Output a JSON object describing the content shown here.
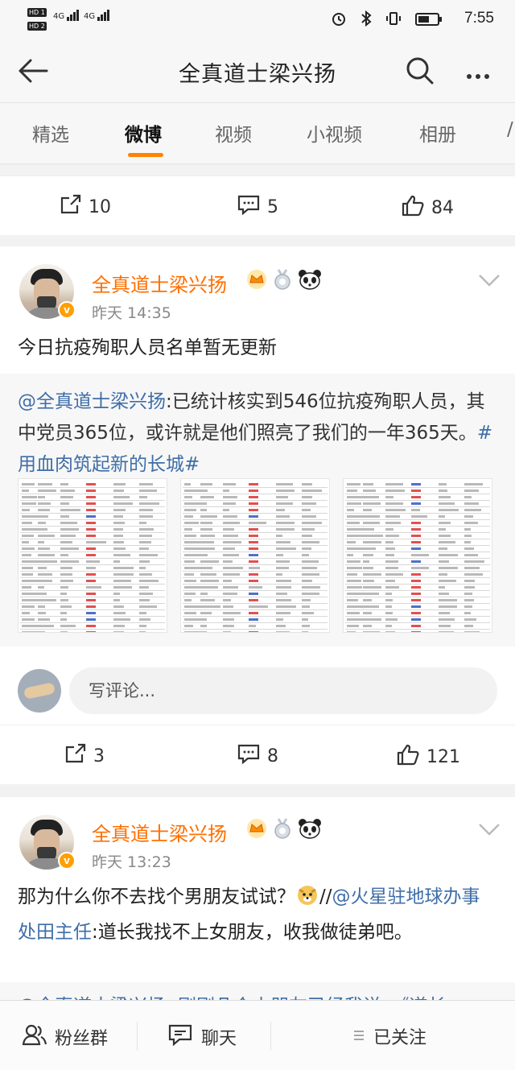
{
  "status_bar": {
    "sim1": "HD 1",
    "sim2": "HD 2",
    "net1": "4G",
    "net2": "4G",
    "time": "7:55"
  },
  "header": {
    "title": "全真道士梁兴扬",
    "icons": [
      "back-arrow-icon",
      "search-icon",
      "more-icon"
    ]
  },
  "tabs": [
    {
      "label": "精选"
    },
    {
      "label": "微博"
    },
    {
      "label": "视频"
    },
    {
      "label": "小视频"
    },
    {
      "label": "相册"
    },
    {
      "label": "/"
    }
  ],
  "top_actions": {
    "repost": "10",
    "comment": "5",
    "like": "84"
  },
  "posts": [
    {
      "author": "全真道士梁兴扬",
      "time": "昨天 14:35",
      "text": "今日抗疫殉职人员名单暂无更新",
      "repost": {
        "mention": "@全真道士梁兴扬",
        "body": ":已统计核实到546位抗疫殉职人员，其中党员365位，或许就是他们照亮了我们的一年365天。",
        "hashtag": "#用血肉筑起新的长城#"
      },
      "comment_placeholder": "写评论...",
      "actions": {
        "repost": "3",
        "comment": "8",
        "like": "121"
      }
    },
    {
      "author": "全真道士梁兴扬",
      "time": "昨天 13:23",
      "text_before": "那为什么你不去找个男朋友试试？",
      "text_sep": "//",
      "mention": "@火星驻地球办事处田主任",
      "text_after": ":道长我找不上女朋友，收我做徒弟吧。",
      "peek": "@全真道士梁兴扬 :刚刚几个小朋友已经我说，《道长"
    }
  ],
  "bottom_bar": {
    "fans_group": "粉丝群",
    "chat": "聊天",
    "following": "已关注"
  },
  "colors": {
    "accent": "#ff8200",
    "username": "#ff6f00",
    "link": "#3f6ea8"
  }
}
